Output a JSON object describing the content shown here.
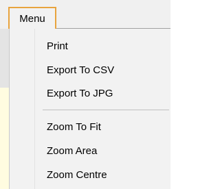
{
  "menu": {
    "label": "Menu",
    "items": [
      {
        "label": "Print"
      },
      {
        "label": "Export To CSV"
      },
      {
        "label": "Export To JPG"
      },
      {
        "label": "Zoom To Fit"
      },
      {
        "label": "Zoom Area"
      },
      {
        "label": "Zoom Centre"
      }
    ]
  },
  "colors": {
    "menu_button_border": "#e8a33d",
    "dropdown_background": "#f2f2f2",
    "separator": "#bfbfbf"
  }
}
